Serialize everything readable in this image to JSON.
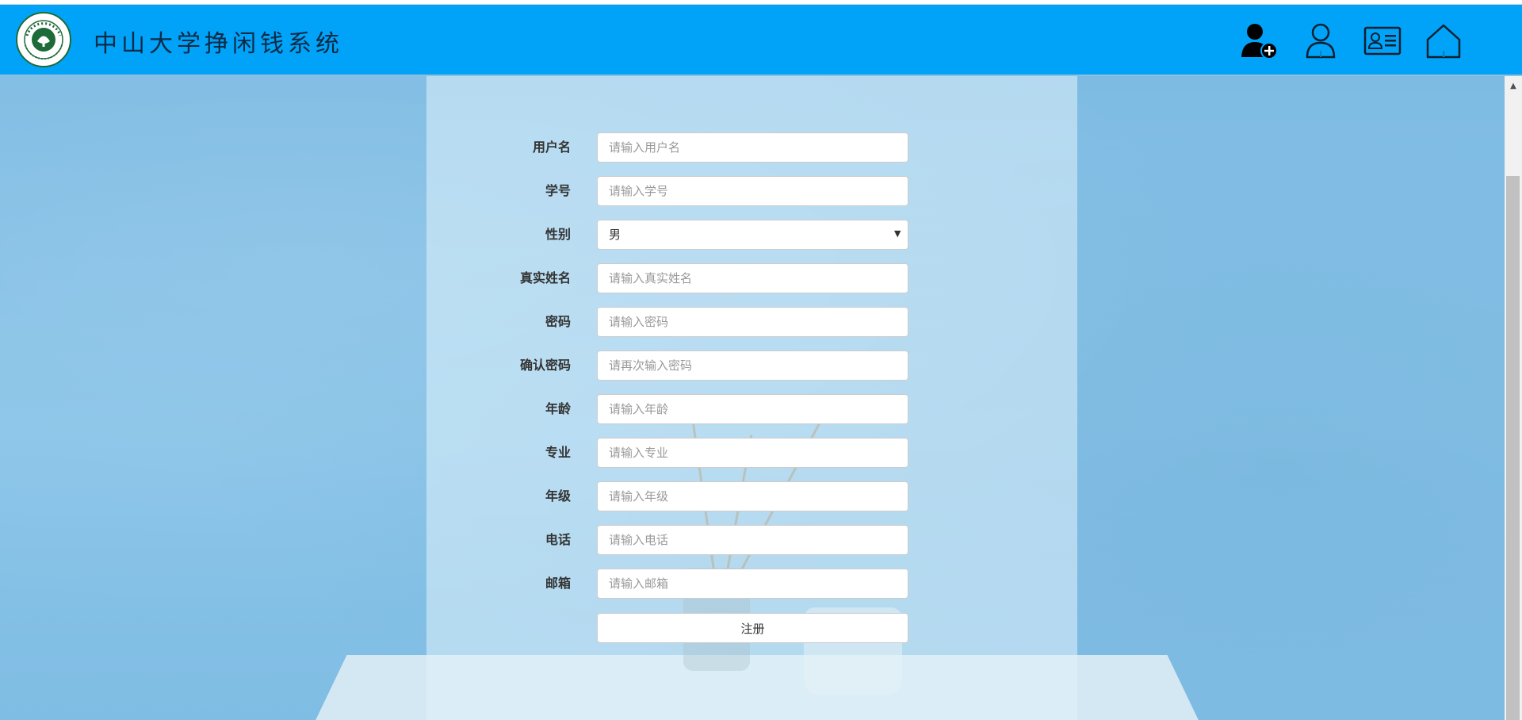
{
  "header": {
    "title": "中山大学挣闲钱系统",
    "logo_name": "university-seal-logo",
    "logo_text": "中山大学 SUN YAT-SEN UNIVERSITY",
    "nav_icons": [
      "add-user-icon",
      "user-profile-icon",
      "id-card-icon",
      "home-icon"
    ],
    "background_color": "#01a3f9"
  },
  "form": {
    "fields": [
      {
        "label": "用户名",
        "placeholder": "请输入用户名",
        "value": ""
      },
      {
        "label": "学号",
        "placeholder": "请输入学号",
        "value": ""
      },
      {
        "label": "性别",
        "selected": "男"
      },
      {
        "label": "真实姓名",
        "placeholder": "请输入真实姓名",
        "value": ""
      },
      {
        "label": "密码",
        "placeholder": "请输入密码",
        "value": ""
      },
      {
        "label": "确认密码",
        "placeholder": "请再次输入密码",
        "value": ""
      },
      {
        "label": "年龄",
        "placeholder": "请输入年龄",
        "value": ""
      },
      {
        "label": "专业",
        "placeholder": "请输入专业",
        "value": ""
      },
      {
        "label": "年级",
        "placeholder": "请输入年级",
        "value": ""
      },
      {
        "label": "电话",
        "placeholder": "请输入电话",
        "value": ""
      },
      {
        "label": "邮箱",
        "placeholder": "请输入邮箱",
        "value": ""
      }
    ],
    "submit_label": "注册"
  }
}
